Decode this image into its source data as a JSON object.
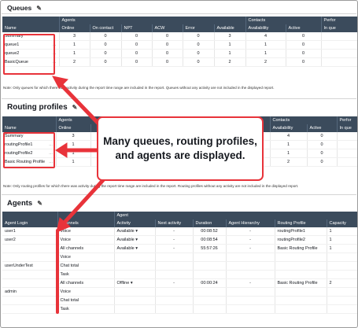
{
  "queues": {
    "title": "Queues",
    "group_headers": [
      "",
      "Agents",
      "Contacts",
      "Perfor"
    ],
    "columns": [
      "Name",
      "Online",
      "On contact",
      "NPT",
      "ACW",
      "Error",
      "Available",
      "Availability",
      "Active",
      "In que"
    ],
    "rows": [
      {
        "name": "Summary",
        "menu": "",
        "values": [
          "3",
          "0",
          "0",
          "0",
          "0",
          "3",
          "4",
          "0",
          ""
        ]
      },
      {
        "name": "queue1",
        "menu": "…",
        "values": [
          "1",
          "0",
          "0",
          "0",
          "0",
          "1",
          "1",
          "0",
          ""
        ]
      },
      {
        "name": "queue2",
        "menu": "…",
        "values": [
          "1",
          "0",
          "0",
          "0",
          "0",
          "1",
          "1",
          "0",
          ""
        ]
      },
      {
        "name": "BasicQueue",
        "menu": "…",
        "values": [
          "2",
          "0",
          "0",
          "0",
          "0",
          "2",
          "2",
          "0",
          ""
        ]
      }
    ],
    "note": "Note: Only queues for which there was activity during the report time range are included in the report. Queues without any activity are not included in the displayed report."
  },
  "routing_profiles": {
    "title": "Routing profiles",
    "group_headers": [
      "",
      "Agents",
      "Contacts",
      "Perfor"
    ],
    "columns": [
      "Name",
      "Online",
      "Availability",
      "Active",
      "In que"
    ],
    "rows": [
      {
        "name": "Summary",
        "menu": "",
        "online": "3",
        "availability": "4",
        "active": "0"
      },
      {
        "name": "routingProfile1",
        "menu": "…",
        "online": "1",
        "availability": "1",
        "active": "0"
      },
      {
        "name": "routingProfile2",
        "menu": "…",
        "online": "1",
        "availability": "1",
        "active": "0"
      },
      {
        "name": "Basic Routing Profile",
        "menu": "…",
        "online": "1",
        "availability": "2",
        "active": "0"
      }
    ],
    "note": "Note: Only routing profiles for which there was activity during the report time range are included in the report. Routing profiles without any activity are not included in the displayed report."
  },
  "agents": {
    "title": "Agents",
    "group_headers": [
      "",
      "",
      "Agent"
    ],
    "columns": [
      "Agent Login",
      "Channels",
      "Activity",
      "Next activity",
      "Duration",
      "Agent Hierarchy",
      "Routing Profile",
      "Capacity"
    ],
    "rows": [
      {
        "login": "user1",
        "channel": "Voice",
        "activity": "Available",
        "dropdown": "▾",
        "next": "-",
        "duration": "00:08:52",
        "hierarchy": "-",
        "profile": "routingProfile1",
        "capacity": "1"
      },
      {
        "login": "user2",
        "channel": "Voice",
        "activity": "Available",
        "dropdown": "▾",
        "next": "-",
        "duration": "00:08:54",
        "hierarchy": "-",
        "profile": "routingProfile2",
        "capacity": "1"
      },
      {
        "login": "",
        "channel": "All channels",
        "activity": "Available",
        "dropdown": "▾",
        "next": "-",
        "duration": "55:57:26",
        "hierarchy": "-",
        "profile": "Basic Routing Profile",
        "capacity": "1"
      },
      {
        "login": "",
        "channel": "Voice",
        "activity": "",
        "dropdown": "",
        "next": "",
        "duration": "",
        "hierarchy": "",
        "profile": "",
        "capacity": ""
      },
      {
        "login": "userUnderTest",
        "channel": "Chat total",
        "activity": "",
        "dropdown": "",
        "next": "",
        "duration": "",
        "hierarchy": "",
        "profile": "",
        "capacity": ""
      },
      {
        "login": "",
        "channel": "Task",
        "activity": "",
        "dropdown": "",
        "next": "",
        "duration": "",
        "hierarchy": "",
        "profile": "",
        "capacity": ""
      },
      {
        "login": "",
        "channel": "All channels",
        "activity": "Offline",
        "dropdown": "▾",
        "next": "-",
        "duration": "00:00:24",
        "hierarchy": "-",
        "profile": "Basic Routing Profile",
        "capacity": "2"
      },
      {
        "login": "admin",
        "channel": "Voice",
        "activity": "",
        "dropdown": "",
        "next": "",
        "duration": "",
        "hierarchy": "",
        "profile": "",
        "capacity": ""
      },
      {
        "login": "",
        "channel": "Chat total",
        "activity": "",
        "dropdown": "",
        "next": "",
        "duration": "",
        "hierarchy": "",
        "profile": "",
        "capacity": ""
      },
      {
        "login": "",
        "channel": "Task",
        "activity": "",
        "dropdown": "",
        "next": "",
        "duration": "",
        "hierarchy": "",
        "profile": "",
        "capacity": ""
      }
    ]
  },
  "callout": {
    "text": "Many queues, routing profiles,\nand agents are displayed."
  },
  "icons": {
    "edit": "pencil-icon",
    "row_menu": "more-options-icon",
    "dropdown": "chevron-down-icon"
  },
  "colors": {
    "header_bg": "#3b4b5c",
    "highlight": "#e8333a"
  }
}
